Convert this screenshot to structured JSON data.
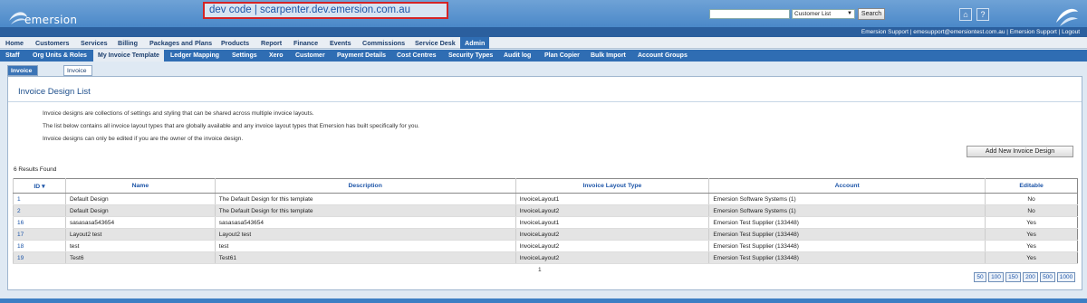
{
  "header": {
    "logo_text": "emersion",
    "dev_banner": "dev code | scarpenter.dev.emersion.com.au",
    "search": {
      "value": "",
      "placeholder": ""
    },
    "search_type": "Customer List",
    "search_button": "Search",
    "icons": [
      "home-icon",
      "help-icon"
    ],
    "user_bar": "Emersion Support | emesupport@emersiontest.com.au | Emersion Support | Logout"
  },
  "nav_main": [
    "Home",
    "Customers",
    "Services",
    "Billing",
    "Packages and Plans",
    "Products",
    "Report",
    "Finance",
    "Events",
    "Commissions",
    "Service Desk",
    "Admin"
  ],
  "nav_main_active": "Admin",
  "nav_sub": [
    "Staff",
    "Org Units & Roles",
    "My Invoice Template",
    "Ledger Mapping",
    "Settings",
    "Xero",
    "Customer",
    "Payment Details",
    "Cost Centres",
    "Security Types",
    "Audit log",
    "Plan Copier",
    "Bulk Import",
    "Account Groups"
  ],
  "nav_sub_active": "My Invoice Template",
  "tabs": [
    "Invoice Designs",
    "Invoice Layouts"
  ],
  "panel": {
    "title": "Invoice Design List",
    "paragraphs": [
      "Invoice designs are collections of settings and styling that can be shared across multiple invoice layouts.",
      "The list below contains all invoice layout types that are globally available and any invoice layout types that Emersion has built specifically for you.",
      "Invoice designs can only be edited if you are the owner of the invoice design."
    ],
    "add_button": "Add New Invoice Design",
    "results_text": "6 Results Found"
  },
  "table": {
    "columns": [
      "ID",
      "Name",
      "Description",
      "Invoice Layout Type",
      "Account",
      "Editable"
    ],
    "rows": [
      [
        "1",
        "Default Design",
        "The Default Design for this template",
        "InvoiceLayout1",
        "Emersion Software Systems (1)",
        "No"
      ],
      [
        "2",
        "Default Design",
        "The Default Design for this template",
        "InvoiceLayout2",
        "Emersion Software Systems (1)",
        "No"
      ],
      [
        "16",
        "sasasasa543654",
        "sasasasa543654",
        "InvoiceLayout1",
        "Emersion Test Supplier (133448)",
        "Yes"
      ],
      [
        "17",
        "Layout2 test",
        "Layout2 test",
        "InvoiceLayout2",
        "Emersion Test Supplier (133448)",
        "Yes"
      ],
      [
        "18",
        "test",
        "test",
        "InvoiceLayout2",
        "Emersion Test Supplier (133448)",
        "Yes"
      ],
      [
        "19",
        "Test6",
        "Test61",
        "InvoiceLayout2",
        "Emersion Test Supplier (133448)",
        "Yes"
      ]
    ]
  },
  "pagination": {
    "current_page": "1",
    "page_sizes": [
      "50",
      "100",
      "150",
      "200",
      "500",
      "1000"
    ]
  },
  "colors": {
    "brand_blue": "#2f6db3",
    "header_light": "#6fa2d6",
    "dev_border": "#d42426",
    "link": "#1d55a8"
  }
}
